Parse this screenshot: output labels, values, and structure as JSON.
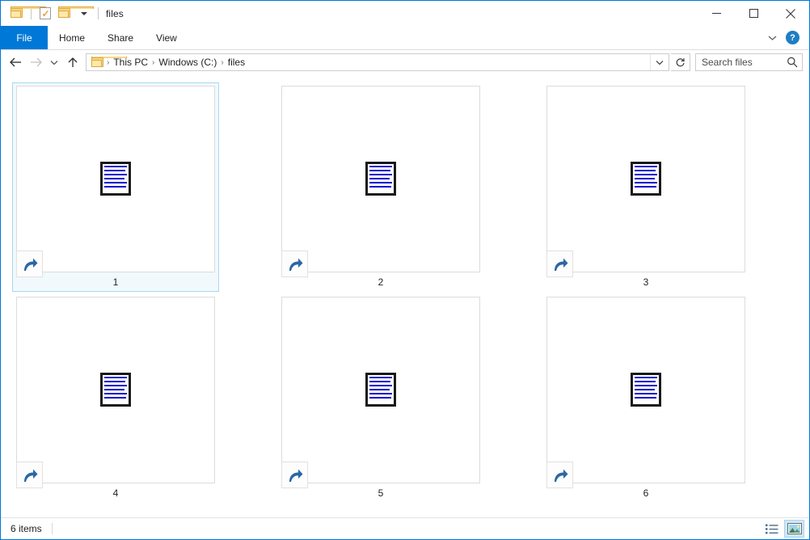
{
  "window": {
    "title": "files",
    "quick_access": [
      {
        "name": "folder-icon",
        "label": "Folder"
      },
      {
        "name": "properties-icon",
        "label": "Properties"
      },
      {
        "name": "new-folder-icon",
        "label": "New folder"
      },
      {
        "name": "customize-caret-icon",
        "label": "Customize Quick Access Toolbar"
      }
    ],
    "controls": {
      "minimize": "minimize-icon",
      "maximize": "maximize-icon",
      "close": "close-icon"
    }
  },
  "ribbon": {
    "tabs": [
      {
        "label": "File",
        "active": true
      },
      {
        "label": "Home",
        "active": false
      },
      {
        "label": "Share",
        "active": false
      },
      {
        "label": "View",
        "active": false
      }
    ],
    "collapse_label": "Minimize the Ribbon",
    "help_label": "?"
  },
  "address": {
    "back_label": "Back",
    "forward_label": "Forward",
    "recent_label": "Recent locations",
    "up_label": "Up",
    "breadcrumbs": [
      "This PC",
      "Windows (C:)",
      "files"
    ],
    "separator": "›",
    "dropdown_label": "Previous locations",
    "refresh_label": "Refresh"
  },
  "search": {
    "placeholder": "Search files",
    "value": "Search files",
    "icon": "search-icon"
  },
  "files": {
    "items": [
      {
        "label": "1",
        "selected": true,
        "icon": "document-thumbnail",
        "shortcut": true
      },
      {
        "label": "2",
        "selected": false,
        "icon": "document-thumbnail",
        "shortcut": true
      },
      {
        "label": "3",
        "selected": false,
        "icon": "document-thumbnail",
        "shortcut": true
      },
      {
        "label": "4",
        "selected": false,
        "icon": "document-thumbnail",
        "shortcut": true
      },
      {
        "label": "5",
        "selected": false,
        "icon": "document-thumbnail",
        "shortcut": true
      },
      {
        "label": "6",
        "selected": false,
        "icon": "document-thumbnail",
        "shortcut": true
      }
    ]
  },
  "status": {
    "count_text": "6 items",
    "views": [
      {
        "name": "details-view-button",
        "active": false
      },
      {
        "name": "large-icons-view-button",
        "active": true
      }
    ]
  },
  "colors": {
    "accent": "#0078d7",
    "selection_border": "#a6d8f5",
    "selection_fill": "#f2f9fd",
    "shortcut_arrow": "#2b66a5",
    "doc_lines": "#1414cf"
  }
}
